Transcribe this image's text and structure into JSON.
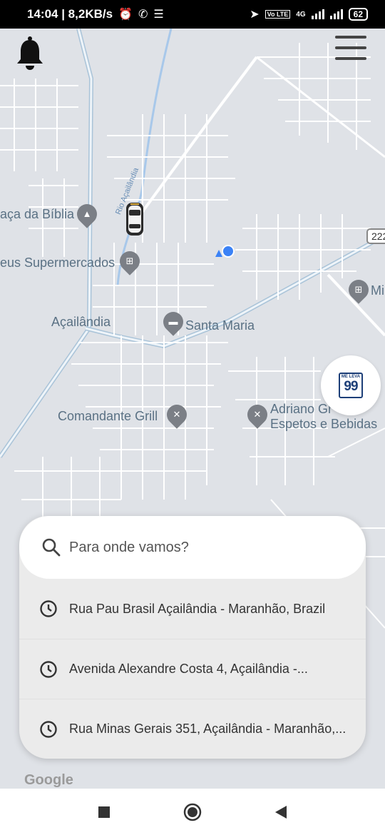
{
  "status_bar": {
    "time_speed": "14:04 | 8,2KB/s",
    "network_badge": "Vo LTE",
    "network_type": "4G",
    "battery": "62"
  },
  "map": {
    "places": [
      {
        "name": "Praça da Bíblia",
        "shown": "aça da Bíblia"
      },
      {
        "name": "Mateus Supermercados",
        "shown": "eus Supermercados"
      },
      {
        "name": "Açailândia"
      },
      {
        "name": "Santa Maria"
      },
      {
        "name": "Comandante Grill"
      },
      {
        "name": "Adriano Grill Espetos e Bebidas",
        "line1": "Adriano Gr",
        "line2": "Espetos e Bebidas"
      },
      {
        "name": "Mi"
      }
    ],
    "road_number": "222",
    "river_label": "Rio Açailândia",
    "google_mark": "Google",
    "colors": {
      "map_bg": "#dfe2e7",
      "road": "#ffffff",
      "label": "#5a7184",
      "water": "#a8c8ea",
      "user_dot": "#3b82f6"
    }
  },
  "brand": {
    "top": "ME LEVA",
    "number": "99"
  },
  "search": {
    "placeholder": "Para onde vamos?"
  },
  "recent": [
    {
      "icon": "clock-icon",
      "text": "Rua Pau Brasil Açailândia - Maranhão, Brazil"
    },
    {
      "icon": "clock-icon",
      "text": "Avenida Alexandre Costa 4, Açailândia -..."
    },
    {
      "icon": "clock-icon",
      "text": "Rua Minas Gerais 351, Açailândia - Maranhão,..."
    }
  ],
  "nav": {
    "recent_icon": "square-icon",
    "home_icon": "circle-icon",
    "back_icon": "triangle-back-icon"
  }
}
